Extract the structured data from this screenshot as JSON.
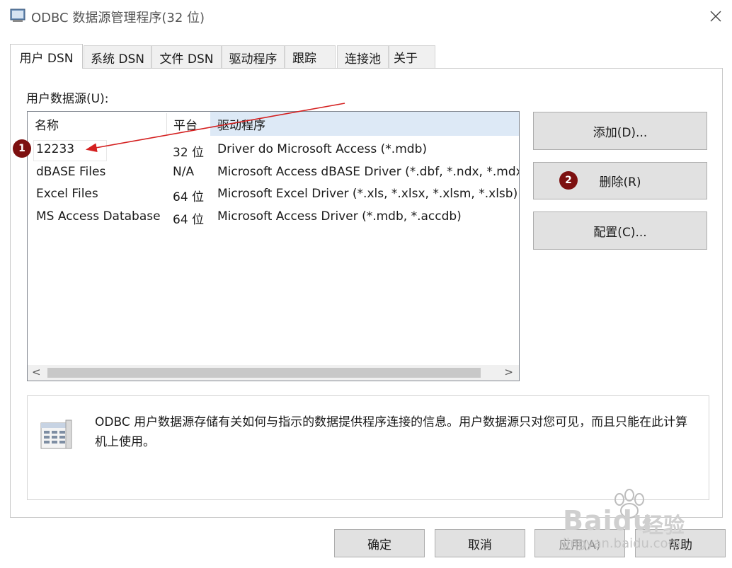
{
  "window": {
    "title": "ODBC 数据源管理程序(32 位)",
    "close_glyph": "✕"
  },
  "tabs": [
    {
      "label": "用户 DSN",
      "active": true
    },
    {
      "label": "系统 DSN",
      "active": false
    },
    {
      "label": "文件 DSN",
      "active": false
    },
    {
      "label": "驱动程序",
      "active": false
    },
    {
      "label": "跟踪",
      "active": false
    },
    {
      "label": "连接池",
      "active": false
    },
    {
      "label": "关于",
      "active": false
    }
  ],
  "user_dsn": {
    "list_label": "用户数据源(U):",
    "columns": [
      "名称",
      "平台",
      "驱动程序"
    ],
    "rows": [
      {
        "name": "12233",
        "platform": "32 位",
        "driver": "Driver do Microsoft Access (*.mdb)"
      },
      {
        "name": "dBASE Files",
        "platform": "N/A",
        "driver": "Microsoft Access dBASE Driver (*.dbf, *.ndx, *.mdx)"
      },
      {
        "name": "Excel Files",
        "platform": "64 位",
        "driver": "Microsoft Excel Driver (*.xls, *.xlsx, *.xlsm, *.xlsb)"
      },
      {
        "name": "MS Access Database",
        "platform": "64 位",
        "driver": "Microsoft Access Driver (*.mdb, *.accdb)"
      }
    ],
    "scroll_left": "<",
    "scroll_right": ">",
    "buttons": {
      "add": "添加(D)...",
      "remove": "删除(R)",
      "configure": "配置(C)..."
    },
    "info_text": "ODBC 用户数据源存储有关如何与指示的数据提供程序连接的信息。用户数据源只对您可见，而且只能在此计算机上使用。"
  },
  "dialog_buttons": {
    "ok": "确定",
    "cancel": "取消",
    "apply": "应用(A)",
    "help": "帮助"
  },
  "annotations": {
    "badge_1": "1",
    "badge_2": "2",
    "arrow_color": "#d42020",
    "badge_color": "#7d1010"
  },
  "watermark": {
    "brand": "Baidu",
    "brand_cn": "经验",
    "url": "jingyan.baidu.com"
  },
  "colors": {
    "header_highlight": "#dde9f6",
    "button_face": "#e1e1e1",
    "tab_face": "#f0f0f0"
  }
}
